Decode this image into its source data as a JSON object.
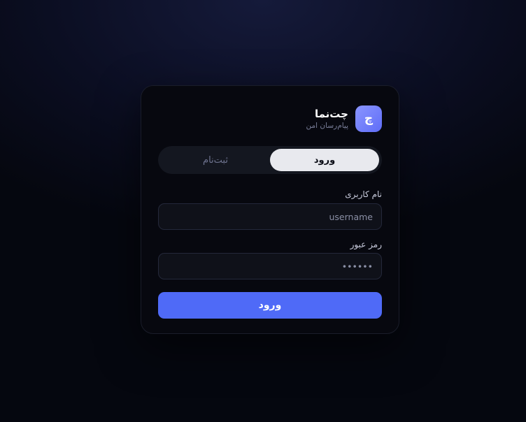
{
  "brand": {
    "logo_letter": "چ",
    "name": "چت‌نما",
    "tagline": "پیام‌رسان امن"
  },
  "tabs": [
    {
      "label": "ورود",
      "active": true
    },
    {
      "label": "ثبت‌نام",
      "active": false
    }
  ],
  "form": {
    "username": {
      "label": "نام کاربری",
      "placeholder": "username",
      "value": ""
    },
    "password": {
      "label": "رمز عبور",
      "placeholder": "••••••",
      "value": ""
    },
    "submit_label": "ورود"
  },
  "colors": {
    "accent": "#4f6af7",
    "logo_gradient_start": "#8a95ff",
    "logo_gradient_end": "#5f6df7",
    "card_background": "#07080f",
    "page_background": "#05070f"
  },
  "icons": {
    "logo": "brand-logo-icon"
  }
}
